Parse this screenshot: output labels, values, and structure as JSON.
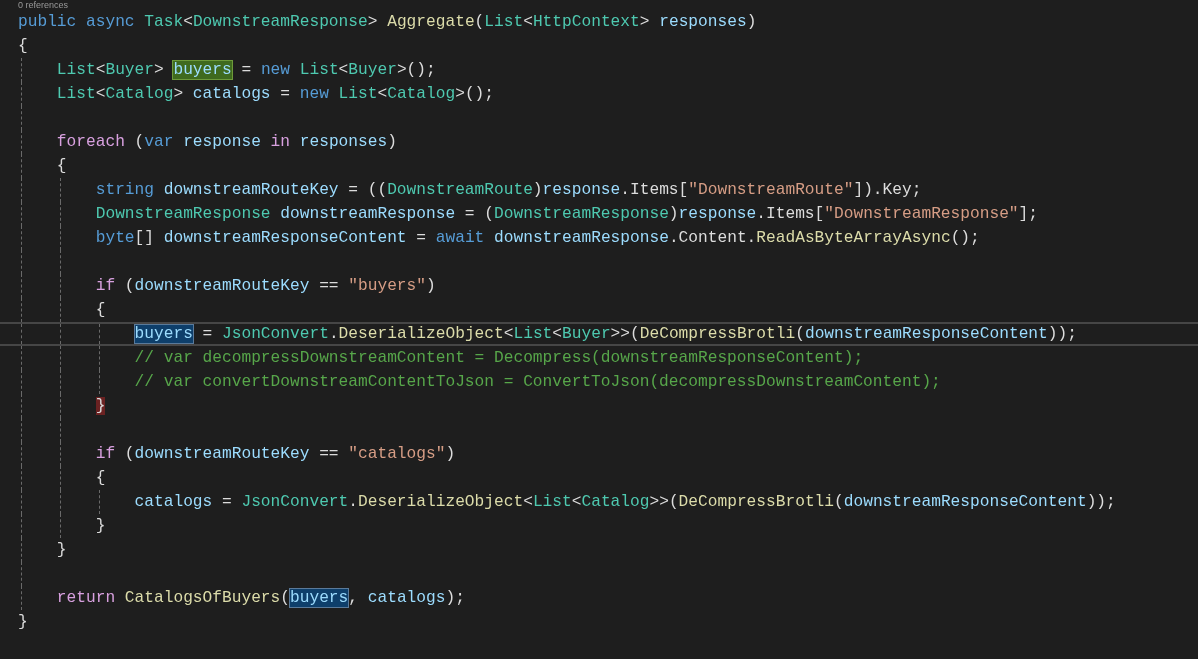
{
  "editor": {
    "codelens": "0 references",
    "lines": [
      {
        "tokens": [
          {
            "t": "public async ",
            "kind": "keyword"
          },
          {
            "t": "Task",
            "kind": "type"
          },
          {
            "t": "<",
            "kind": "plain"
          },
          {
            "t": "DownstreamResponse",
            "kind": "type"
          },
          {
            "t": "> ",
            "kind": "plain"
          },
          {
            "t": "Aggregate",
            "kind": "method"
          },
          {
            "t": "(",
            "kind": "plain"
          },
          {
            "t": "List",
            "kind": "type"
          },
          {
            "t": "<",
            "kind": "plain"
          },
          {
            "t": "HttpContext",
            "kind": "type"
          },
          {
            "t": "> ",
            "kind": "plain"
          },
          {
            "t": "responses",
            "kind": "variable"
          },
          {
            "t": ")",
            "kind": "plain"
          }
        ]
      },
      {
        "tokens": [
          {
            "t": "{",
            "kind": "plain"
          }
        ],
        "children": [
          {
            "tokens": [
              {
                "t": "List",
                "kind": "type"
              },
              {
                "t": "<",
                "kind": "plain"
              },
              {
                "t": "Buyer",
                "kind": "type"
              },
              {
                "t": "> ",
                "kind": "plain"
              },
              {
                "t": "buyers",
                "kind": "variable",
                "definition": true
              },
              {
                "t": " = ",
                "kind": "plain"
              },
              {
                "t": "new ",
                "kind": "keyword"
              },
              {
                "t": "List",
                "kind": "type"
              },
              {
                "t": "<",
                "kind": "plain"
              },
              {
                "t": "Buyer",
                "kind": "type"
              },
              {
                "t": ">();",
                "kind": "plain"
              }
            ]
          },
          {
            "tokens": [
              {
                "t": "List",
                "kind": "type"
              },
              {
                "t": "<",
                "kind": "plain"
              },
              {
                "t": "Catalog",
                "kind": "type"
              },
              {
                "t": "> ",
                "kind": "plain"
              },
              {
                "t": "catalogs",
                "kind": "variable"
              },
              {
                "t": " = ",
                "kind": "plain"
              },
              {
                "t": "new ",
                "kind": "keyword"
              },
              {
                "t": "List",
                "kind": "type"
              },
              {
                "t": "<",
                "kind": "plain"
              },
              {
                "t": "Catalog",
                "kind": "type"
              },
              {
                "t": ">();",
                "kind": "plain"
              }
            ]
          },
          {
            "gap_before": true,
            "tokens": [
              {
                "t": "foreach",
                "kind": "control"
              },
              {
                "t": " (",
                "kind": "plain"
              },
              {
                "t": "var ",
                "kind": "keyword"
              },
              {
                "t": "response ",
                "kind": "variable"
              },
              {
                "t": "in ",
                "kind": "control"
              },
              {
                "t": "responses",
                "kind": "variable"
              },
              {
                "t": ")",
                "kind": "plain"
              }
            ]
          },
          {
            "tokens": [
              {
                "t": "{",
                "kind": "plain"
              }
            ],
            "children": [
              {
                "tokens": [
                  {
                    "t": "string ",
                    "kind": "keyword"
                  },
                  {
                    "t": "downstreamRouteKey",
                    "kind": "variable"
                  },
                  {
                    "t": " = ((",
                    "kind": "plain"
                  },
                  {
                    "t": "DownstreamRoute",
                    "kind": "type"
                  },
                  {
                    "t": ")",
                    "kind": "plain"
                  },
                  {
                    "t": "response",
                    "kind": "variable"
                  },
                  {
                    "t": ".Items[",
                    "kind": "plain"
                  },
                  {
                    "t": "\"DownstreamRoute\"",
                    "kind": "string"
                  },
                  {
                    "t": "]).Key;",
                    "kind": "plain"
                  }
                ]
              },
              {
                "tokens": [
                  {
                    "t": "DownstreamResponse ",
                    "kind": "type"
                  },
                  {
                    "t": "downstreamResponse",
                    "kind": "variable"
                  },
                  {
                    "t": " = (",
                    "kind": "plain"
                  },
                  {
                    "t": "DownstreamResponse",
                    "kind": "type"
                  },
                  {
                    "t": ")",
                    "kind": "plain"
                  },
                  {
                    "t": "response",
                    "kind": "variable"
                  },
                  {
                    "t": ".Items[",
                    "kind": "plain"
                  },
                  {
                    "t": "\"DownstreamResponse\"",
                    "kind": "string"
                  },
                  {
                    "t": "];",
                    "kind": "plain"
                  }
                ]
              },
              {
                "tokens": [
                  {
                    "t": "byte",
                    "kind": "keyword"
                  },
                  {
                    "t": "[] ",
                    "kind": "plain"
                  },
                  {
                    "t": "downstreamResponseContent",
                    "kind": "variable"
                  },
                  {
                    "t": " = ",
                    "kind": "plain"
                  },
                  {
                    "t": "await ",
                    "kind": "keyword"
                  },
                  {
                    "t": "downstreamResponse",
                    "kind": "variable"
                  },
                  {
                    "t": ".Content.",
                    "kind": "plain"
                  },
                  {
                    "t": "ReadAsByteArrayAsync",
                    "kind": "method"
                  },
                  {
                    "t": "();",
                    "kind": "plain"
                  }
                ]
              },
              {
                "gap_before": true,
                "tokens": [
                  {
                    "t": "if",
                    "kind": "control"
                  },
                  {
                    "t": " (",
                    "kind": "plain"
                  },
                  {
                    "t": "downstreamRouteKey",
                    "kind": "variable"
                  },
                  {
                    "t": " == ",
                    "kind": "plain"
                  },
                  {
                    "t": "\"buyers\"",
                    "kind": "string"
                  },
                  {
                    "t": ")",
                    "kind": "plain"
                  }
                ]
              },
              {
                "tokens": [
                  {
                    "t": "{",
                    "kind": "plain"
                  }
                ],
                "children": [
                  {
                    "current": true,
                    "tokens": [
                      {
                        "t": "buyers",
                        "kind": "variable",
                        "reference": true
                      },
                      {
                        "t": " = ",
                        "kind": "plain"
                      },
                      {
                        "t": "JsonConvert",
                        "kind": "type"
                      },
                      {
                        "t": ".",
                        "kind": "plain"
                      },
                      {
                        "t": "DeserializeObject",
                        "kind": "method"
                      },
                      {
                        "t": "<",
                        "kind": "plain"
                      },
                      {
                        "t": "List",
                        "kind": "type"
                      },
                      {
                        "t": "<",
                        "kind": "plain"
                      },
                      {
                        "t": "Buyer",
                        "kind": "type"
                      },
                      {
                        "t": ">>(",
                        "kind": "plain"
                      },
                      {
                        "t": "DeCompressBrotli",
                        "kind": "method"
                      },
                      {
                        "t": "(",
                        "kind": "plain"
                      },
                      {
                        "t": "downstreamResponseContent",
                        "kind": "variable"
                      },
                      {
                        "t": "));",
                        "kind": "plain"
                      }
                    ]
                  },
                  {
                    "tokens": [
                      {
                        "t": "// var decompressDownstreamContent = Decompress(downstreamResponseContent);",
                        "kind": "comment"
                      }
                    ]
                  },
                  {
                    "tokens": [
                      {
                        "t": "// var convertDownstreamContentToJson = ConvertToJson(decompressDownstreamContent);",
                        "kind": "comment"
                      }
                    ]
                  }
                ]
              },
              {
                "tokens": [
                  {
                    "t": "}",
                    "kind": "plain",
                    "matched_brace": true
                  }
                ]
              },
              {
                "gap_before": true,
                "tokens": [
                  {
                    "t": "if",
                    "kind": "control"
                  },
                  {
                    "t": " (",
                    "kind": "plain"
                  },
                  {
                    "t": "downstreamRouteKey",
                    "kind": "variable"
                  },
                  {
                    "t": " == ",
                    "kind": "plain"
                  },
                  {
                    "t": "\"catalogs\"",
                    "kind": "string"
                  },
                  {
                    "t": ")",
                    "kind": "plain"
                  }
                ]
              },
              {
                "tokens": [
                  {
                    "t": "{",
                    "kind": "plain"
                  }
                ],
                "children": [
                  {
                    "tokens": [
                      {
                        "t": "catalogs",
                        "kind": "variable"
                      },
                      {
                        "t": " = ",
                        "kind": "plain"
                      },
                      {
                        "t": "JsonConvert",
                        "kind": "type"
                      },
                      {
                        "t": ".",
                        "kind": "plain"
                      },
                      {
                        "t": "DeserializeObject",
                        "kind": "method"
                      },
                      {
                        "t": "<",
                        "kind": "plain"
                      },
                      {
                        "t": "List",
                        "kind": "type"
                      },
                      {
                        "t": "<",
                        "kind": "plain"
                      },
                      {
                        "t": "Catalog",
                        "kind": "type"
                      },
                      {
                        "t": ">>(",
                        "kind": "plain"
                      },
                      {
                        "t": "DeCompressBrotli",
                        "kind": "method"
                      },
                      {
                        "t": "(",
                        "kind": "plain"
                      },
                      {
                        "t": "downstreamResponseContent",
                        "kind": "variable"
                      },
                      {
                        "t": "));",
                        "kind": "plain"
                      }
                    ]
                  }
                ]
              },
              {
                "tokens": [
                  {
                    "t": "}",
                    "kind": "plain"
                  }
                ]
              }
            ]
          },
          {
            "tokens": [
              {
                "t": "}",
                "kind": "plain"
              }
            ]
          },
          {
            "gap_before": true,
            "tokens": [
              {
                "t": "return ",
                "kind": "control"
              },
              {
                "t": "CatalogsOfBuyers",
                "kind": "method"
              },
              {
                "t": "(",
                "kind": "plain"
              },
              {
                "t": "buyers",
                "kind": "variable",
                "reference": true
              },
              {
                "t": ", ",
                "kind": "plain"
              },
              {
                "t": "catalogs",
                "kind": "variable"
              },
              {
                "t": ");",
                "kind": "plain"
              }
            ]
          }
        ]
      },
      {
        "tokens": [
          {
            "t": "}",
            "kind": "plain"
          }
        ]
      }
    ]
  }
}
